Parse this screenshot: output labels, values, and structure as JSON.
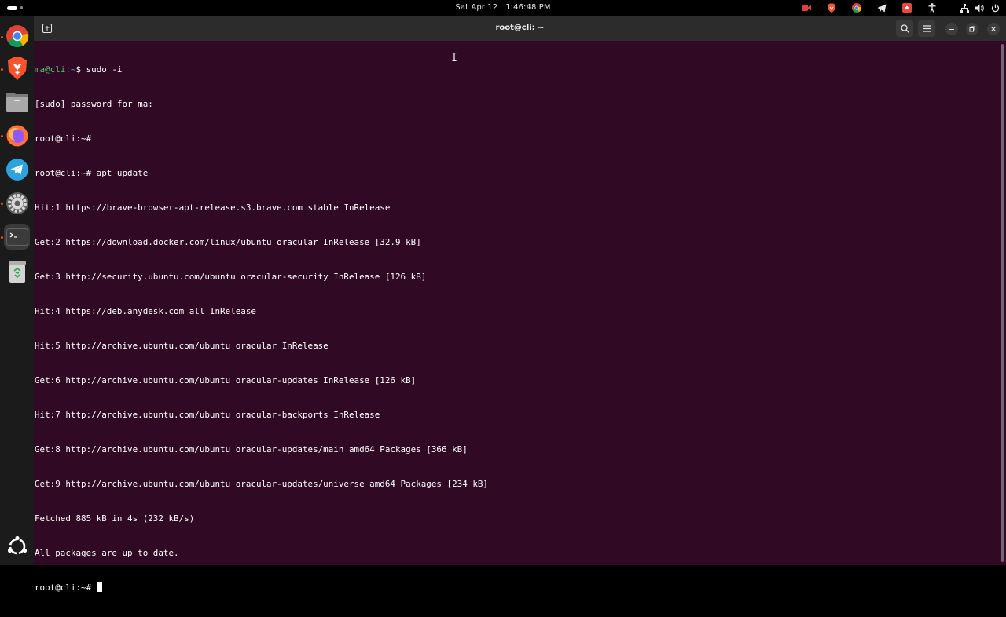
{
  "topbar": {
    "date": "Sat Apr 12",
    "time": "1:46:48 PM"
  },
  "dock": {
    "items": [
      {
        "name": "chrome",
        "icon": "chrome-icon"
      },
      {
        "name": "brave",
        "icon": "brave-icon"
      },
      {
        "name": "files",
        "icon": "files-icon"
      },
      {
        "name": "firefox",
        "icon": "firefox-icon"
      },
      {
        "name": "telegram",
        "icon": "telegram-icon"
      },
      {
        "name": "settings",
        "icon": "gear-icon"
      },
      {
        "name": "terminal",
        "icon": "terminal-icon"
      },
      {
        "name": "trash",
        "icon": "trash-icon"
      },
      {
        "name": "show-apps",
        "icon": "ubuntu-logo-icon"
      }
    ]
  },
  "window": {
    "title": "root@cli: ~"
  },
  "terminal": {
    "lines": [
      {
        "user": "ma@cli",
        "path": ":~",
        "sym": "$ ",
        "cmd": "sudo -i"
      },
      {
        "text": "[sudo] password for ma:"
      },
      {
        "text": "root@cli:~#"
      },
      {
        "text": "root@cli:~# apt update"
      },
      {
        "text": "Hit:1 https://brave-browser-apt-release.s3.brave.com stable InRelease"
      },
      {
        "text": "Get:2 https://download.docker.com/linux/ubuntu oracular InRelease [32.9 kB]"
      },
      {
        "text": "Get:3 http://security.ubuntu.com/ubuntu oracular-security InRelease [126 kB]"
      },
      {
        "text": "Hit:4 https://deb.anydesk.com all InRelease"
      },
      {
        "text": "Hit:5 http://archive.ubuntu.com/ubuntu oracular InRelease"
      },
      {
        "text": "Get:6 http://archive.ubuntu.com/ubuntu oracular-updates InRelease [126 kB]"
      },
      {
        "text": "Hit:7 http://archive.ubuntu.com/ubuntu oracular-backports InRelease"
      },
      {
        "text": "Get:8 http://archive.ubuntu.com/ubuntu oracular-updates/main amd64 Packages [366 kB]"
      },
      {
        "text": "Get:9 http://archive.ubuntu.com/ubuntu oracular-updates/universe amd64 Packages [234 kB]"
      },
      {
        "text": "Fetched 885 kB in 4s (232 kB/s)"
      },
      {
        "text": "All packages are up to date."
      },
      {
        "text": "root@cli:~# "
      }
    ]
  },
  "colors": {
    "terminal_bg": "#300a24",
    "prompt_user": "#4ec96f",
    "prompt_path": "#6f8fd8",
    "accent": "#e95420"
  }
}
